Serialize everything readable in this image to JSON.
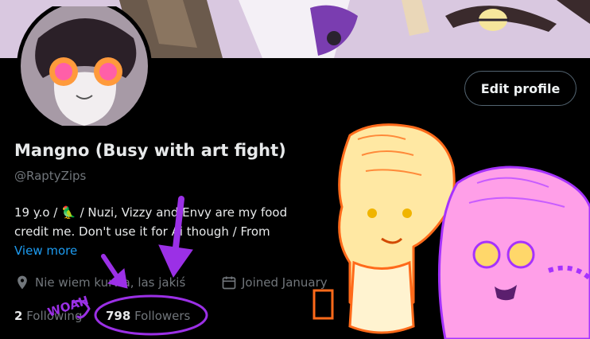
{
  "profile": {
    "display_name": "Mangno (Busy with art fight)",
    "handle": "@RaptyZips",
    "bio_line1": "19 y.o / 🦜 / Nuzi, Vizzy and Envy are my food",
    "bio_line2": "credit me. Don't use it for Ai though / From",
    "view_more": "View more",
    "location": "Nie wiem kurwa, las jakiś",
    "joined": "Joined January",
    "following_count": "2",
    "following_label": "Following",
    "followers_count": "798",
    "followers_label": "Followers"
  },
  "actions": {
    "edit_profile": "Edit profile"
  },
  "doodle": {
    "text": "WOAH"
  },
  "icons": [
    "location-pin-icon",
    "calendar-icon",
    "parrot-emoji-icon",
    "poland-flag-icon"
  ],
  "colors": {
    "accent": "#1d9bf0",
    "doodle_purple": "#9b30e6",
    "muted": "#71767b"
  }
}
